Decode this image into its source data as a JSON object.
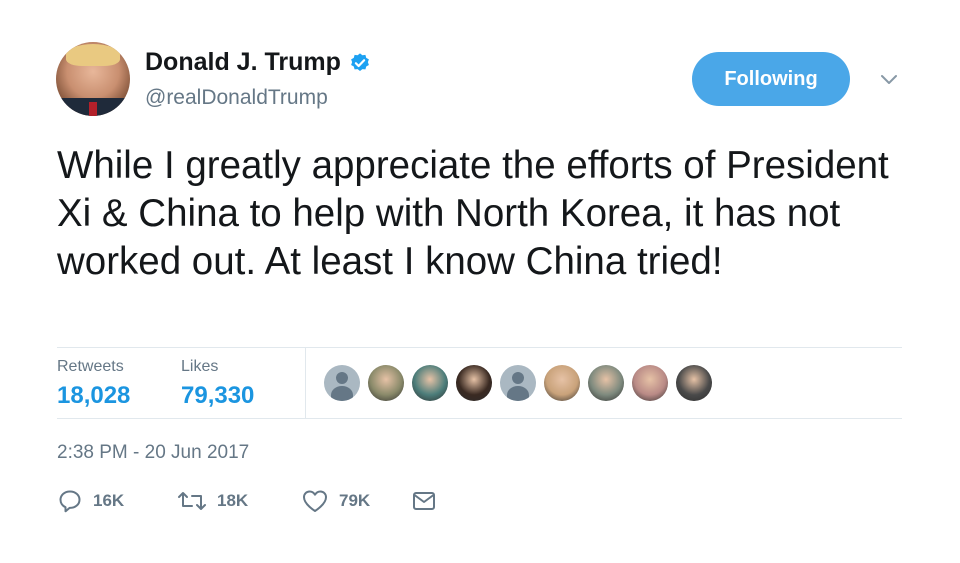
{
  "author": {
    "name": "Donald J. Trump",
    "handle": "@realDonaldTrump",
    "verified": true
  },
  "follow_button": {
    "label": "Following"
  },
  "tweet": {
    "text": "While I greatly appreciate the efforts of President Xi & China to help with North Korea, it has not worked out. At least I know China tried!"
  },
  "stats": {
    "retweets_label": "Retweets",
    "retweets_value": "18,028",
    "likes_label": "Likes",
    "likes_value": "79,330"
  },
  "liker_avatars": [
    {
      "kind": "default"
    },
    {
      "kind": "photo",
      "color": "#8a8a6a"
    },
    {
      "kind": "photo",
      "color": "#4c7d7a"
    },
    {
      "kind": "photo",
      "color": "#3a2a22"
    },
    {
      "kind": "default"
    },
    {
      "kind": "photo",
      "color": "#c9a27a"
    },
    {
      "kind": "photo",
      "color": "#7e8a7e"
    },
    {
      "kind": "photo",
      "color": "#b98a86"
    },
    {
      "kind": "photo",
      "color": "#4a4a4a"
    }
  ],
  "timestamp": "2:38 PM - 20 Jun 2017",
  "actions": {
    "reply_count": "16K",
    "retweet_count": "18K",
    "like_count": "79K"
  },
  "colors": {
    "accent": "#1b95e0",
    "button_bg": "#4aa7e8",
    "muted": "#657786",
    "border": "#e1e8ed"
  },
  "icons": [
    "verified-badge-icon",
    "chevron-down-icon",
    "reply-icon",
    "retweet-icon",
    "heart-icon",
    "envelope-icon"
  ]
}
